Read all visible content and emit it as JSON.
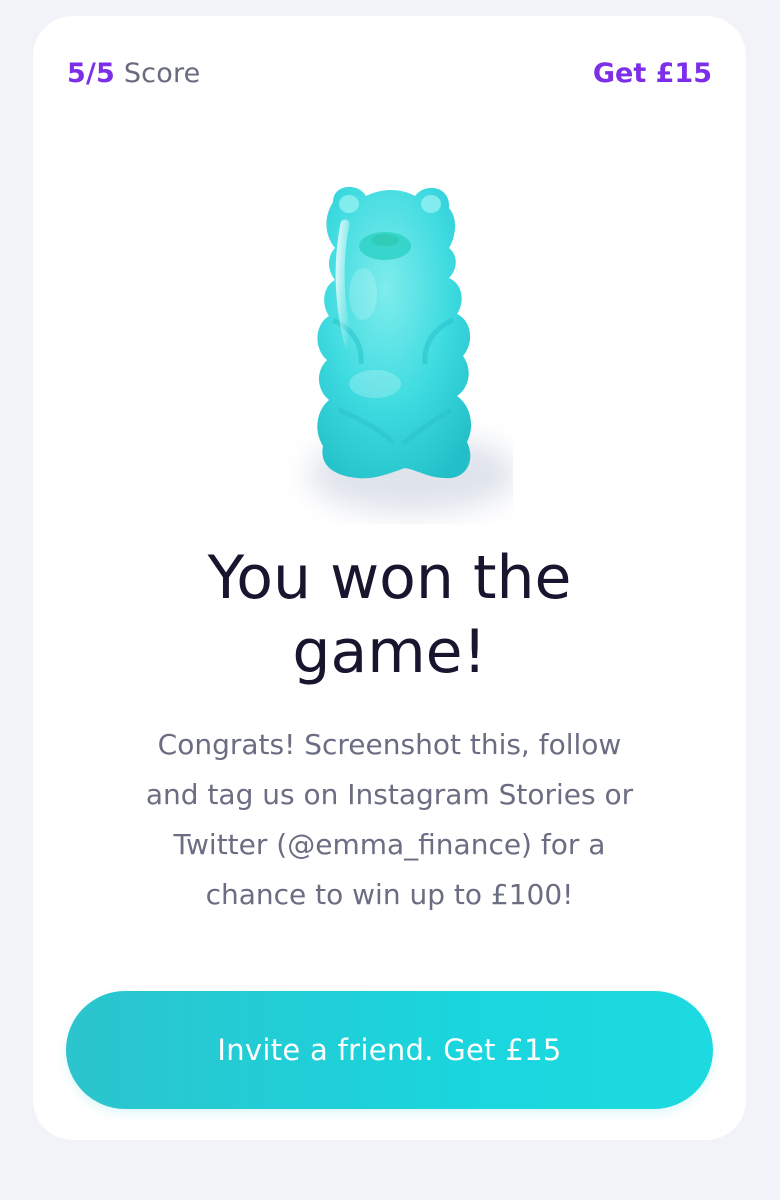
{
  "header": {
    "score_value": "5/5",
    "score_label": "Score",
    "reward_label": "Get £15"
  },
  "illustration": {
    "icon": "gummy-bear-icon",
    "color": "#3ddbe0"
  },
  "main": {
    "title_line1": "You won the",
    "title_line2": "game!",
    "body_line1": "Congrats! Screenshot this, follow",
    "body_line2": "and tag us on Instagram Stories or",
    "body_line3": "Twitter (@emma_finance) for a",
    "body_line4": "chance to win up to £100!"
  },
  "cta": {
    "label": "Invite a friend. Get £15"
  },
  "colors": {
    "accent_purple": "#7d2ee8",
    "accent_teal": "#1ad5dd",
    "background": "#f2f3f8",
    "card": "#ffffff",
    "title_text": "#18152e",
    "body_text": "#6b6e82"
  }
}
